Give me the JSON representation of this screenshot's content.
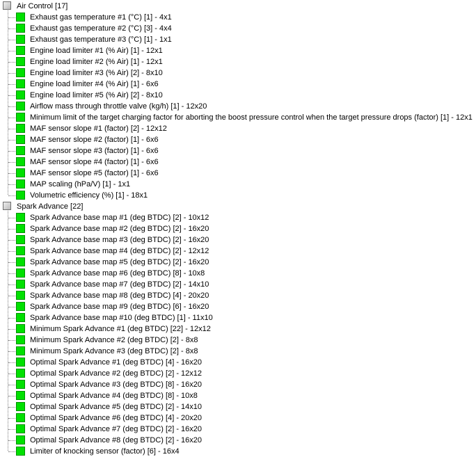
{
  "tree": {
    "groups": [
      {
        "label": "Air Control [17]",
        "icon": "group-node-icon",
        "items": [
          "Exhaust gas temperature #1 (°C) [1] - 4x1",
          "Exhaust gas temperature #2 (°C) [3] - 4x4",
          "Exhaust gas temperature #3 (°C) [1] - 1x1",
          "Engine load limiter #1 (% Air) [1] - 12x1",
          "Engine load limiter #2 (% Air) [1] - 12x1",
          "Engine load limiter #3 (% Air) [2] - 8x10",
          "Engine load limiter #4 (% Air) [1] - 6x6",
          "Engine load limiter #5 (% Air) [2] - 8x10",
          "Airflow mass through throttle valve (kg/h) [1] - 12x20",
          "Minimum limit of the target charging factor for aborting the boost pressure control when the target pressure drops (factor) [1] - 12x1",
          "MAF sensor slope #1 (factor) [2] - 12x12",
          "MAF sensor slope #2 (factor) [1] - 6x6",
          "MAF sensor slope #3 (factor) [1] - 6x6",
          "MAF sensor slope #4 (factor) [1] - 6x6",
          "MAF sensor slope #5 (factor) [1] - 6x6",
          "MAP scaling (hPa/V) [1] - 1x1",
          "Volumetric efficiency (%) [1] - 18x1"
        ]
      },
      {
        "label": "Spark Advance [22]",
        "icon": "group-node-icon",
        "items": [
          "Spark Advance base map #1 (deg BTDC) [2] - 10x12",
          "Spark Advance base map #2 (deg BTDC) [2] - 16x20",
          "Spark Advance base map #3 (deg BTDC) [2] - 16x20",
          "Spark Advance base map #4 (deg BTDC) [2] - 12x12",
          "Spark Advance base map #5 (deg BTDC) [2] - 16x20",
          "Spark Advance base map #6 (deg BTDC) [8] - 10x8",
          "Spark Advance base map #7 (deg BTDC) [2] - 14x10",
          "Spark Advance base map #8 (deg BTDC) [4] - 20x20",
          "Spark Advance base map #9 (deg BTDC) [6] - 16x20",
          "Spark Advance base map #10 (deg BTDC) [1] - 11x10",
          "Minimum Spark Advance #1 (deg BTDC) [22] - 12x12",
          "Minimum Spark Advance #2 (deg BTDC) [2] - 8x8",
          "Minimum Spark Advance #3 (deg BTDC) [2] - 8x8",
          "Optimal Spark Advance #1 (deg BTDC) [4] - 16x20",
          "Optimal Spark Advance #2 (deg BTDC) [2] - 12x12",
          "Optimal Spark Advance #3 (deg BTDC) [8] - 16x20",
          "Optimal Spark Advance #4 (deg BTDC) [8] - 10x8",
          "Optimal Spark Advance #5 (deg BTDC) [2] - 14x10",
          "Optimal Spark Advance #6 (deg BTDC) [4] - 20x20",
          "Optimal Spark Advance #7 (deg BTDC) [2] - 16x20",
          "Optimal Spark Advance #8 (deg BTDC) [2] - 16x20",
          "Limiter of knocking sensor (factor) [6] - 16x4"
        ]
      }
    ],
    "colors": {
      "leaf_fill": "#00e000",
      "leaf_border": "#009000",
      "tree_line": "#7f7f7f",
      "group_fill": "#cfcfcf"
    },
    "leaf_icon": "map-node-icon"
  }
}
